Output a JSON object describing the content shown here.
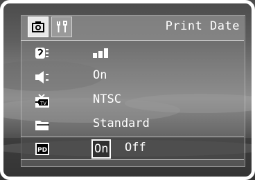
{
  "header": {
    "title": "Print Date",
    "tabs": [
      {
        "icon": "camera-icon",
        "active": true
      },
      {
        "icon": "setup-tools-icon",
        "active": false
      }
    ]
  },
  "menu": {
    "items": [
      {
        "icon": "sound-icon",
        "value": "",
        "level_bars": 3
      },
      {
        "icon": "beep-icon",
        "value": "On"
      },
      {
        "icon": "video-out-icon",
        "value": "NTSC"
      },
      {
        "icon": "folder-icon",
        "value": "Standard"
      },
      {
        "icon": "print-date-icon",
        "options": [
          "On",
          "Off"
        ],
        "selected": "On"
      }
    ]
  }
}
